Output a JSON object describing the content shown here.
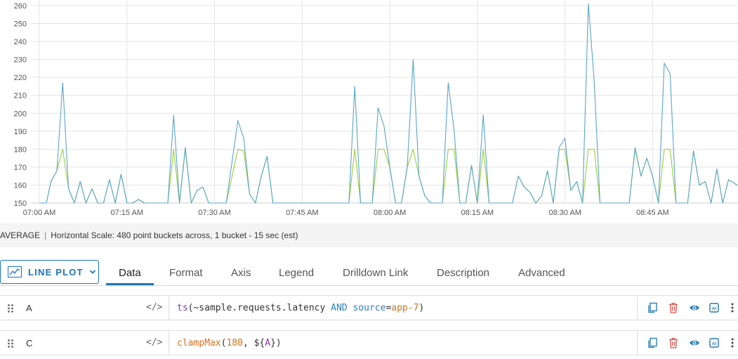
{
  "chart_data": {
    "type": "line",
    "title": "",
    "xlabel": "",
    "ylabel": "",
    "ylim": [
      150,
      262
    ],
    "y_ticks": [
      150,
      160,
      170,
      180,
      190,
      200,
      210,
      220,
      230,
      240,
      250,
      260
    ],
    "x_ticks": [
      "07:00 AM",
      "07:15 AM",
      "07:30 AM",
      "07:45 AM",
      "08:00 AM",
      "08:15 AM",
      "08:30 AM",
      "08:45 AM"
    ],
    "x_range_minutes": [
      0,
      119.5
    ],
    "grid": true,
    "legend": "none",
    "series": [
      {
        "color": "#5aa5c9",
        "points": [
          [
            0,
            150
          ],
          [
            1.2,
            150
          ],
          [
            2,
            162
          ],
          [
            3,
            168
          ],
          [
            4,
            217
          ],
          [
            5,
            158
          ],
          [
            6,
            150
          ],
          [
            7,
            162
          ],
          [
            8,
            150
          ],
          [
            9,
            158
          ],
          [
            10,
            150
          ],
          [
            11,
            150
          ],
          [
            12,
            163
          ],
          [
            13,
            150
          ],
          [
            14,
            166
          ],
          [
            15,
            150
          ],
          [
            16,
            150
          ],
          [
            17,
            152
          ],
          [
            18,
            150
          ],
          [
            19,
            150
          ],
          [
            20,
            150
          ],
          [
            21,
            150
          ],
          [
            22,
            150
          ],
          [
            23,
            199
          ],
          [
            24,
            150
          ],
          [
            25,
            181
          ],
          [
            26,
            150
          ],
          [
            27,
            157
          ],
          [
            28,
            159
          ],
          [
            29,
            150
          ],
          [
            30,
            150
          ],
          [
            31,
            150
          ],
          [
            32,
            150
          ],
          [
            34,
            196
          ],
          [
            35,
            186
          ],
          [
            36,
            155
          ],
          [
            37,
            150
          ],
          [
            38,
            165
          ],
          [
            39,
            176
          ],
          [
            40,
            150
          ],
          [
            41,
            150
          ],
          [
            42,
            150
          ],
          [
            43,
            150
          ],
          [
            45,
            150
          ],
          [
            47,
            150
          ],
          [
            49,
            150
          ],
          [
            51,
            150
          ],
          [
            53,
            150
          ],
          [
            54,
            215
          ],
          [
            55,
            150
          ],
          [
            56,
            150
          ],
          [
            57,
            150
          ],
          [
            58,
            203
          ],
          [
            59,
            193
          ],
          [
            60,
            170
          ],
          [
            61,
            150
          ],
          [
            62,
            150
          ],
          [
            63,
            170
          ],
          [
            64,
            230
          ],
          [
            65,
            165
          ],
          [
            66,
            154
          ],
          [
            67,
            150
          ],
          [
            68,
            150
          ],
          [
            69,
            150
          ],
          [
            70,
            217
          ],
          [
            71,
            191
          ],
          [
            72,
            150
          ],
          [
            73,
            150
          ],
          [
            74,
            171
          ],
          [
            75,
            150
          ],
          [
            76,
            199
          ],
          [
            77,
            150
          ],
          [
            78,
            150
          ],
          [
            79,
            150
          ],
          [
            80,
            150
          ],
          [
            81,
            150
          ],
          [
            82,
            165
          ],
          [
            83,
            159
          ],
          [
            84,
            156
          ],
          [
            85,
            150
          ],
          [
            86,
            154
          ],
          [
            87,
            168
          ],
          [
            88,
            150
          ],
          [
            89,
            181
          ],
          [
            90,
            186
          ],
          [
            91,
            157
          ],
          [
            92,
            162
          ],
          [
            93,
            150
          ],
          [
            94,
            261
          ],
          [
            95,
            218
          ],
          [
            96,
            150
          ],
          [
            97,
            150
          ],
          [
            98,
            150
          ],
          [
            99,
            150
          ],
          [
            100,
            150
          ],
          [
            101,
            150
          ],
          [
            102,
            181
          ],
          [
            103,
            165
          ],
          [
            104,
            175
          ],
          [
            105,
            165
          ],
          [
            106,
            150
          ],
          [
            107,
            228
          ],
          [
            108,
            222
          ],
          [
            109,
            150
          ],
          [
            110,
            150
          ],
          [
            111,
            150
          ],
          [
            112,
            179
          ],
          [
            113,
            160
          ],
          [
            114,
            162
          ],
          [
            115,
            150
          ],
          [
            116,
            169
          ],
          [
            117,
            150
          ],
          [
            118,
            163
          ],
          [
            119.5,
            160
          ]
        ]
      },
      {
        "color": "#9acd3c",
        "points": [
          [
            0,
            150
          ],
          [
            1.2,
            150
          ],
          [
            2,
            162
          ],
          [
            3,
            168
          ],
          [
            4,
            180
          ],
          [
            5,
            158
          ],
          [
            6,
            150
          ],
          [
            7,
            162
          ],
          [
            8,
            150
          ],
          [
            9,
            158
          ],
          [
            10,
            150
          ],
          [
            11,
            150
          ],
          [
            12,
            163
          ],
          [
            13,
            150
          ],
          [
            14,
            166
          ],
          [
            15,
            150
          ],
          [
            16,
            150
          ],
          [
            17,
            152
          ],
          [
            18,
            150
          ],
          [
            19,
            150
          ],
          [
            20,
            150
          ],
          [
            21,
            150
          ],
          [
            22,
            150
          ],
          [
            23,
            180
          ],
          [
            24,
            150
          ],
          [
            25,
            180
          ],
          [
            26,
            150
          ],
          [
            27,
            157
          ],
          [
            28,
            159
          ],
          [
            29,
            150
          ],
          [
            30,
            150
          ],
          [
            31,
            150
          ],
          [
            32,
            150
          ],
          [
            34,
            180
          ],
          [
            35,
            179
          ],
          [
            36,
            155
          ],
          [
            37,
            150
          ],
          [
            38,
            165
          ],
          [
            39,
            176
          ],
          [
            40,
            150
          ],
          [
            41,
            150
          ],
          [
            42,
            150
          ],
          [
            43,
            150
          ],
          [
            45,
            150
          ],
          [
            47,
            150
          ],
          [
            49,
            150
          ],
          [
            51,
            150
          ],
          [
            53,
            150
          ],
          [
            54,
            180
          ],
          [
            55,
            150
          ],
          [
            56,
            150
          ],
          [
            57,
            150
          ],
          [
            58,
            180
          ],
          [
            59,
            180
          ],
          [
            60,
            170
          ],
          [
            61,
            150
          ],
          [
            62,
            150
          ],
          [
            63,
            170
          ],
          [
            64,
            180
          ],
          [
            65,
            165
          ],
          [
            66,
            154
          ],
          [
            67,
            150
          ],
          [
            68,
            150
          ],
          [
            69,
            150
          ],
          [
            70,
            180
          ],
          [
            71,
            180
          ],
          [
            72,
            150
          ],
          [
            73,
            150
          ],
          [
            74,
            171
          ],
          [
            75,
            150
          ],
          [
            76,
            180
          ],
          [
            77,
            150
          ],
          [
            78,
            150
          ],
          [
            79,
            150
          ],
          [
            80,
            150
          ],
          [
            81,
            150
          ],
          [
            82,
            165
          ],
          [
            83,
            159
          ],
          [
            84,
            156
          ],
          [
            85,
            150
          ],
          [
            86,
            154
          ],
          [
            87,
            168
          ],
          [
            88,
            150
          ],
          [
            89,
            180
          ],
          [
            90,
            180
          ],
          [
            91,
            157
          ],
          [
            92,
            162
          ],
          [
            93,
            150
          ],
          [
            94,
            180
          ],
          [
            95,
            180
          ],
          [
            96,
            150
          ],
          [
            97,
            150
          ],
          [
            98,
            150
          ],
          [
            99,
            150
          ],
          [
            100,
            150
          ],
          [
            101,
            150
          ],
          [
            102,
            180
          ],
          [
            103,
            165
          ],
          [
            104,
            175
          ],
          [
            105,
            165
          ],
          [
            106,
            150
          ],
          [
            107,
            180
          ],
          [
            108,
            180
          ],
          [
            109,
            150
          ],
          [
            110,
            150
          ],
          [
            111,
            150
          ],
          [
            112,
            179
          ],
          [
            113,
            160
          ],
          [
            114,
            162
          ],
          [
            115,
            150
          ],
          [
            116,
            169
          ],
          [
            117,
            150
          ],
          [
            118,
            163
          ],
          [
            119.5,
            160
          ]
        ]
      }
    ]
  },
  "status": {
    "summarization": "AVERAGE",
    "separator": "|",
    "scale_text": "Horizontal Scale: 480 point buckets across, 1 bucket - 15 sec (est)"
  },
  "toolbar": {
    "plot_type_label": "LINE PLOT",
    "plot_type_icon": "line-chart-icon",
    "tabs": [
      {
        "label": "Data",
        "active": true
      },
      {
        "label": "Format"
      },
      {
        "label": "Axis"
      },
      {
        "label": "Legend"
      },
      {
        "label": "Drilldown Link"
      },
      {
        "label": "Description"
      },
      {
        "label": "Advanced"
      }
    ],
    "accent": "#1f77b4"
  },
  "queries": [
    {
      "name": "A",
      "toggle": "</>",
      "text": "ts(~sample.requests.latency AND source=app-7)",
      "tokens": [
        {
          "t": "ts",
          "c": "tk-fn"
        },
        {
          "t": "(~sample.requests.latency ",
          "c": "tk-plain"
        },
        {
          "t": "AND",
          "c": "tk-kw"
        },
        {
          "t": " ",
          "c": "tk-plain"
        },
        {
          "t": "source",
          "c": "tk-src"
        },
        {
          "t": "=",
          "c": "tk-plain"
        },
        {
          "t": "app-7",
          "c": "tk-fn2"
        },
        {
          "t": ")",
          "c": "tk-plain"
        }
      ]
    },
    {
      "name": "C",
      "toggle": "</>",
      "text": "clampMax(180, ${A})",
      "tokens": [
        {
          "t": "clampMax",
          "c": "tk-fn2"
        },
        {
          "t": "(",
          "c": "tk-plain"
        },
        {
          "t": "180",
          "c": "tk-num"
        },
        {
          "t": ", ",
          "c": "tk-plain"
        },
        {
          "t": "${",
          "c": "tk-plain"
        },
        {
          "t": "A",
          "c": "tk-var"
        },
        {
          "t": "})",
          "c": "tk-plain"
        }
      ]
    }
  ],
  "row_actions": [
    "copy-icon",
    "delete-icon",
    "eye-icon",
    "ai-icon",
    "more-icon"
  ]
}
